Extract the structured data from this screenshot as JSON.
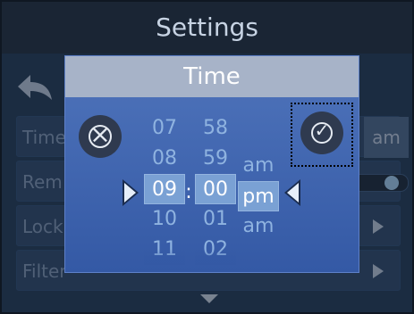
{
  "header": {
    "title": "Settings"
  },
  "settings_list": [
    {
      "label": "Time",
      "value_suffix": "am"
    },
    {
      "label": "Rem",
      "toggle": true
    },
    {
      "label": "Lock"
    },
    {
      "label": "Filter"
    }
  ],
  "time_dialog": {
    "title": "Time",
    "hours": [
      "07",
      "08",
      "09",
      "10",
      "11"
    ],
    "minutes": [
      "58",
      "59",
      "00",
      "01",
      "02"
    ],
    "ampm": [
      "am",
      "pm",
      "am"
    ],
    "separator": ":",
    "selected": {
      "hour": "09",
      "minute": "00",
      "ampm": "pm"
    }
  },
  "icons": {
    "back": "back-arrow-icon",
    "cancel": "cancel-icon",
    "confirm": "confirm-check-icon",
    "row_arrow": "chevron-right-icon",
    "scroll_down": "chevron-down-icon"
  },
  "colors": {
    "screen": "#243b55",
    "header": "#1a2534",
    "dialog": "#4f74bb",
    "dialog_title_bar": "#a7b3c8",
    "selected_cell": "#7aa1d4",
    "button": "#2f3a4f"
  }
}
